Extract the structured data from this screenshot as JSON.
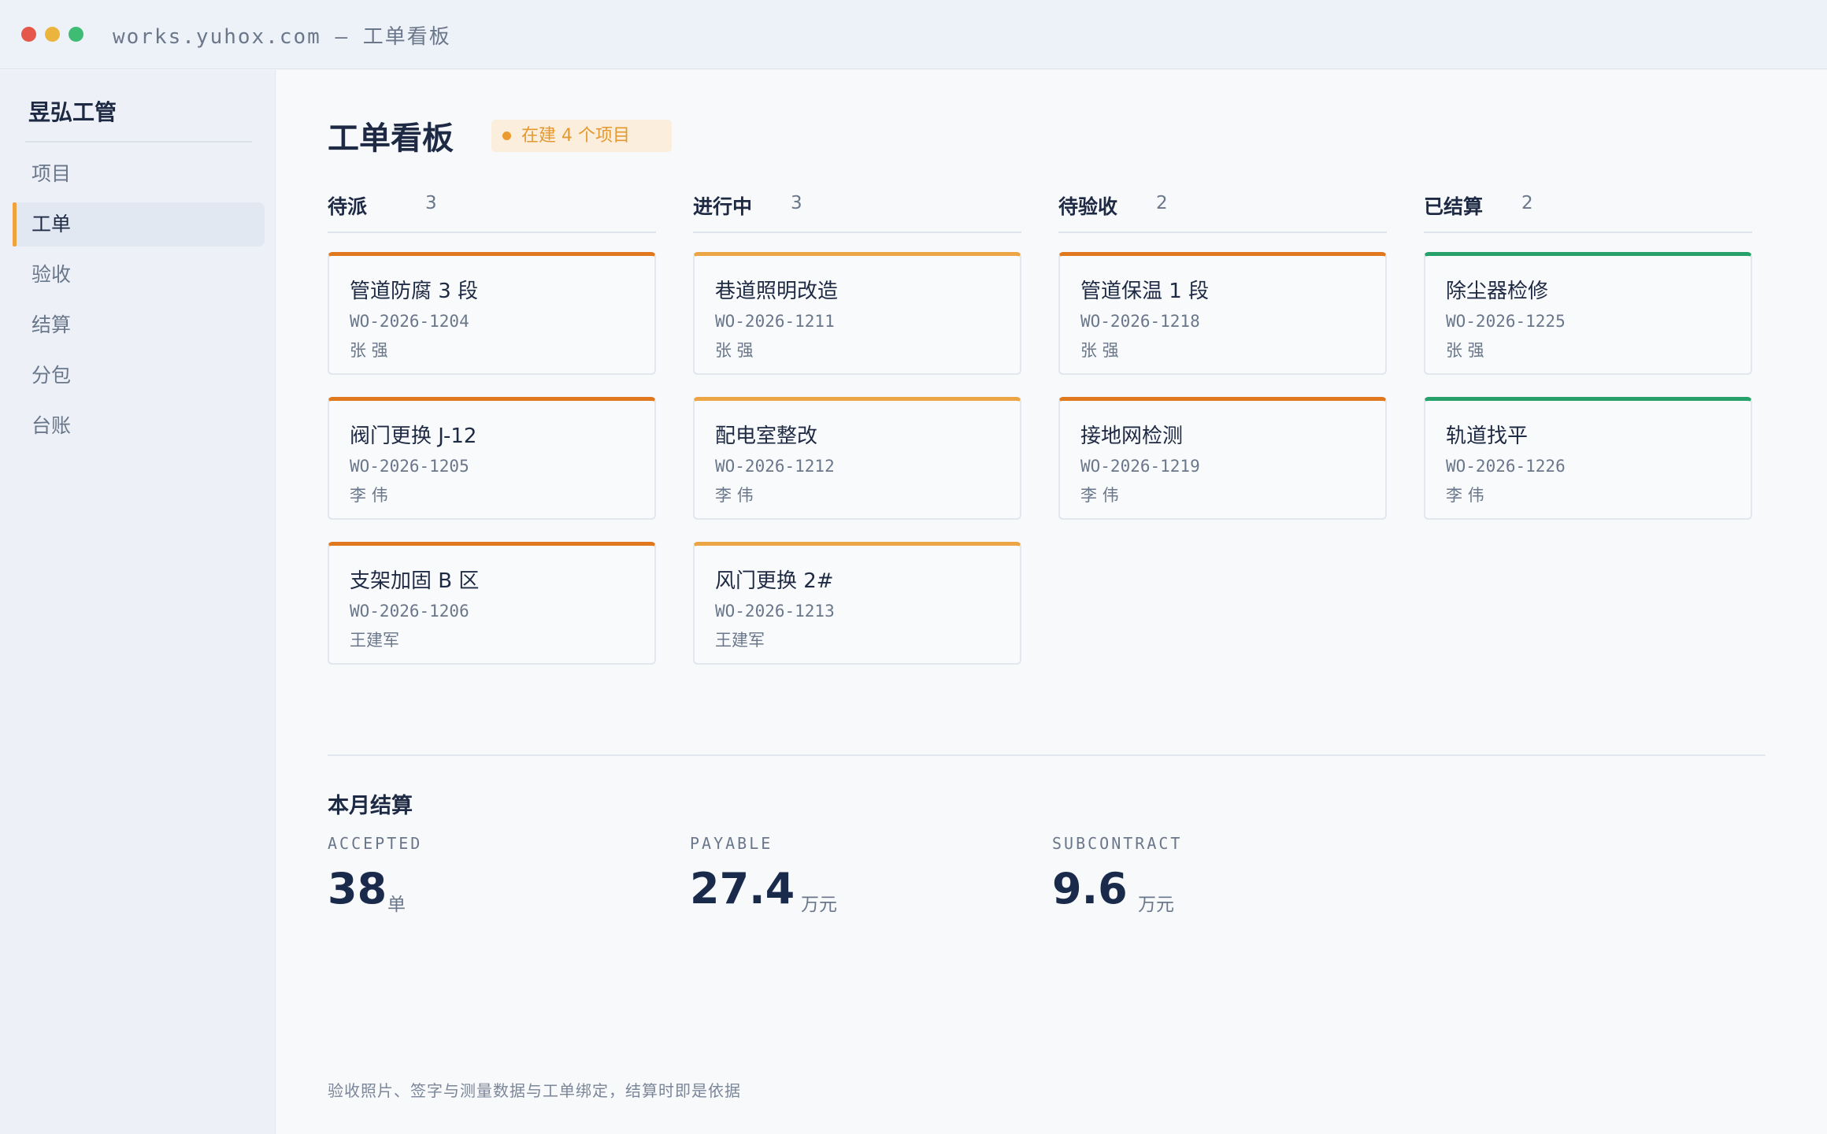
{
  "window": {
    "url_title": "works.yuhox.com — 工单看板"
  },
  "sidebar": {
    "brand": "昱弘工管",
    "items": [
      {
        "label": "项目",
        "active": false
      },
      {
        "label": "工单",
        "active": true
      },
      {
        "label": "验收",
        "active": false
      },
      {
        "label": "结算",
        "active": false
      },
      {
        "label": "分包",
        "active": false
      },
      {
        "label": "台账",
        "active": false
      }
    ]
  },
  "header": {
    "title": "工单看板",
    "badge": "在建 4 个项目"
  },
  "colors": {
    "pending_stripe": "#e0781f",
    "in_progress_stripe": "#eba544",
    "to_accept_stripe": "#e0781f",
    "settled_stripe": "#27a06a",
    "accent": "#f0a23c"
  },
  "board": {
    "columns": [
      {
        "name": "待派",
        "count": "3",
        "cards": [
          {
            "title": "管道防腐 3 段",
            "code": "WO-2026-1204",
            "owner": "张 强"
          },
          {
            "title": "阀门更换 J-12",
            "code": "WO-2026-1205",
            "owner": "李 伟"
          },
          {
            "title": "支架加固 B 区",
            "code": "WO-2026-1206",
            "owner": "王建军"
          }
        ]
      },
      {
        "name": "进行中",
        "count": "3",
        "cards": [
          {
            "title": "巷道照明改造",
            "code": "WO-2026-1211",
            "owner": "张 强"
          },
          {
            "title": "配电室整改",
            "code": "WO-2026-1212",
            "owner": "李 伟"
          },
          {
            "title": "风门更换 2#",
            "code": "WO-2026-1213",
            "owner": "王建军"
          }
        ]
      },
      {
        "name": "待验收",
        "count": "2",
        "cards": [
          {
            "title": "管道保温 1 段",
            "code": "WO-2026-1218",
            "owner": "张 强"
          },
          {
            "title": "接地网检测",
            "code": "WO-2026-1219",
            "owner": "李 伟"
          }
        ]
      },
      {
        "name": "已结算",
        "count": "2",
        "cards": [
          {
            "title": "除尘器检修",
            "code": "WO-2026-1225",
            "owner": "张 强"
          },
          {
            "title": "轨道找平",
            "code": "WO-2026-1226",
            "owner": "李 伟"
          }
        ]
      }
    ]
  },
  "settlement": {
    "title": "本月结算",
    "stats": [
      {
        "label": "ACCEPTED",
        "value": "38",
        "unit": "单"
      },
      {
        "label": "PAYABLE",
        "value": "27.4",
        "unit": "万元"
      },
      {
        "label": "SUBCONTRACT",
        "value": "9.6",
        "unit": "万元"
      }
    ]
  },
  "footer": {
    "note": "验收照片、签字与测量数据与工单绑定，结算时即是依据"
  }
}
